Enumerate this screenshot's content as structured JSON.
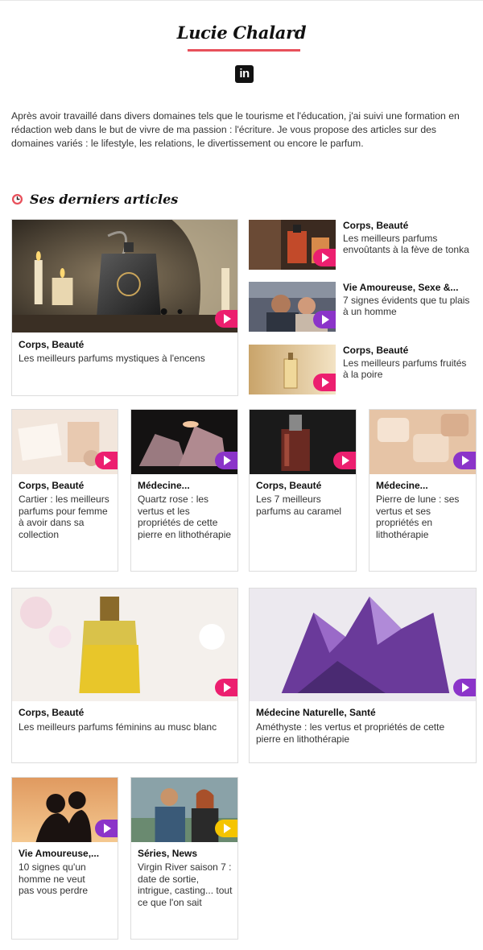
{
  "author": {
    "name": "Lucie Chalard",
    "linkedin_label": "in",
    "bio": "Après avoir travaillé dans divers domaines tels que le tourisme et l'éducation, j'ai suivi une formation en rédaction web dans le but de vivre de ma passion : l'écriture. Je vous propose des articles sur des domaines variés : le lifestyle, les relations, le divertissement ou encore le parfum."
  },
  "section": {
    "title": "Ses derniers articles",
    "icon": "clock-icon"
  },
  "colors": {
    "accent": "#e8505b",
    "play_pink": "#ec1f6f",
    "play_purple": "#8b34c9",
    "play_yellow": "#f5c400"
  },
  "featured": {
    "category": "Corps, Beauté",
    "title": "Les meilleurs parfums mystiques à l'encens"
  },
  "side_articles": [
    {
      "category": "Corps, Beauté",
      "title": "Les meilleurs parfums envoûtants à la fève de tonka"
    },
    {
      "category": "Vie Amoureuse, Sexe &...",
      "title": "7 signes évidents que tu plais à un homme"
    },
    {
      "category": "Corps, Beauté",
      "title": "Les meilleurs parfums fruités à la poire"
    }
  ],
  "grid_row1": [
    {
      "category": "Corps, Beauté",
      "title": "Cartier : les meilleurs parfums pour femme à avoir dans sa collection"
    },
    {
      "category": "Médecine...",
      "title": "Quartz rose : les vertus et les propriétés de cette pierre en lithothérapie"
    },
    {
      "category": "Corps, Beauté",
      "title": "Les 7 meilleurs parfums au caramel"
    },
    {
      "category": "Médecine...",
      "title": "Pierre de lune : ses vertus et ses propriétés en lithothérapie"
    }
  ],
  "wide_row": [
    {
      "category": "Corps, Beauté",
      "title": "Les meilleurs parfums féminins au musc blanc"
    },
    {
      "category": "Médecine Naturelle, Santé",
      "title": "Améthyste : les vertus et propriétés de cette pierre en lithothérapie"
    }
  ],
  "grid_row2": [
    {
      "category": "Vie Amoureuse,...",
      "title": "10 signes qu'un homme ne veut pas vous perdre"
    },
    {
      "category": "Séries, News",
      "title": "Virgin River saison 7 : date de sortie, intrigue, casting... tout ce que l'on sait"
    }
  ]
}
